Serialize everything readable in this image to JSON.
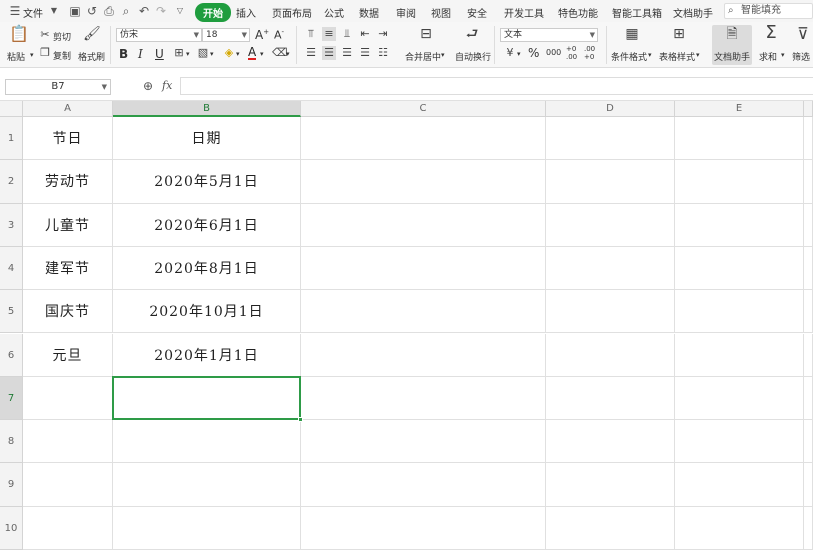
{
  "menubar": {
    "file": "文件",
    "tabs": [
      "开始",
      "插入",
      "页面布局",
      "公式",
      "数据",
      "审阅",
      "视图",
      "安全",
      "开发工具",
      "特色功能",
      "智能工具箱",
      "文档助手"
    ],
    "active_tab": "开始",
    "search_placeholder": "智能填充"
  },
  "ribbon": {
    "paste": "粘贴",
    "cut": "剪切",
    "copy": "复制",
    "format_painter": "格式刷",
    "font_name": "仿宋",
    "font_size": "18",
    "bold": "B",
    "italic": "I",
    "underline": "U",
    "merge_center": "合并居中",
    "wrap_text": "自动换行",
    "number_format": "文本",
    "percent": "%",
    "thousands": "000",
    "inc_decimal": "+0 .00",
    "dec_decimal": ".00 +0",
    "conditional_format": "条件格式",
    "table_style": "表格样式",
    "doc_assistant": "文档助手",
    "sum": "求和",
    "filter": "筛选"
  },
  "formula_bar": {
    "name_box": "B7",
    "fx": "fx",
    "content": ""
  },
  "columns": [
    "A",
    "B",
    "C",
    "D",
    "E"
  ],
  "selected_column": "B",
  "rows": [
    "1",
    "2",
    "3",
    "4",
    "5",
    "6",
    "7",
    "8",
    "9",
    "10"
  ],
  "selected_row": "7",
  "cells": [
    [
      "节日",
      "日期"
    ],
    [
      "劳动节",
      "2020年5月1日"
    ],
    [
      "儿童节",
      "2020年6月1日"
    ],
    [
      "建军节",
      "2020年8月1日"
    ],
    [
      "国庆节",
      "2020年10月1日"
    ],
    [
      "元旦",
      "2020年1月1日"
    ]
  ],
  "colors": {
    "accent": "#1f9d3e",
    "selection": "#2e9b47"
  }
}
